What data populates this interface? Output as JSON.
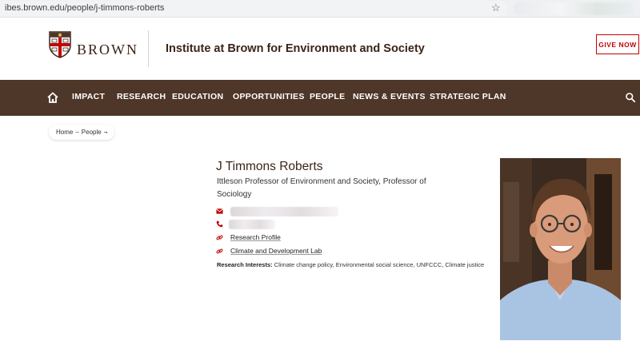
{
  "browser": {
    "url": "ibes.brown.edu/people/j-timmons-roberts"
  },
  "header": {
    "brand_word": "BROWN",
    "institute_name": "Institute at Brown for Environment and Society",
    "give_now_label": "GIVE NOW"
  },
  "nav": {
    "home_icon": "home-icon",
    "items": [
      "IMPACT",
      "RESEARCH",
      "EDUCATION",
      "OPPORTUNITIES",
      "PEOPLE",
      "NEWS & EVENTS",
      "STRATEGIC PLAN"
    ],
    "search_icon": "search-icon"
  },
  "breadcrumb": {
    "home": "Home",
    "separator": "–",
    "current": "People",
    "caret": "¬"
  },
  "profile": {
    "name": "J Timmons Roberts",
    "title": "Ittleson Professor of Environment and Society, Professor of Sociology",
    "email_icon": "envelope-icon",
    "phone_icon": "phone-icon",
    "links": [
      {
        "label": "Research Profile",
        "icon": "link-icon"
      },
      {
        "label": "Climate and Development Lab",
        "icon": "link-icon"
      }
    ],
    "interests_label": "Research Interests:",
    "interests_value": "Climate change policy, Environmental social science, UNFCCC, Climate justice"
  },
  "colors": {
    "brown_primary": "#4e3629",
    "brown_red": "#c00404",
    "text_dark": "#3b2418"
  }
}
